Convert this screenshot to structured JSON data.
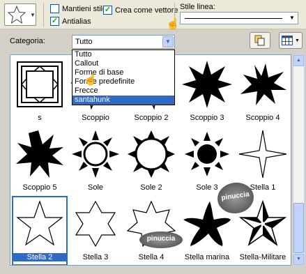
{
  "toolbar": {
    "mantieni_stile": "Mantieni stile",
    "antialias": "Antialias",
    "crea_come_vettore": "Crea come vettore",
    "stile_linea_label": "Stile linea:"
  },
  "categoria": {
    "label": "Categoria:",
    "selected": "Tutto",
    "options": [
      "Tutto",
      "Callout",
      "Forme di base",
      "Forme predefinite",
      "Frecce",
      "santahunk"
    ],
    "highlighted_index": 5
  },
  "shapes": [
    {
      "label": "s"
    },
    {
      "label": "Scoppio"
    },
    {
      "label": "Scoppio 2"
    },
    {
      "label": "Scoppio 3"
    },
    {
      "label": "Scoppio 4"
    },
    {
      "label": "Scoppio 5"
    },
    {
      "label": "Sole"
    },
    {
      "label": "Sole 2"
    },
    {
      "label": "Sole 3"
    },
    {
      "label": "Stella 1"
    },
    {
      "label": "Stella 2"
    },
    {
      "label": "Stella 3"
    },
    {
      "label": "Stella 4"
    },
    {
      "label": "Stella marina"
    },
    {
      "label": "Stella-Militare"
    }
  ],
  "selected_shape": "Stella 2",
  "watermark": "pinuccia",
  "colors": {
    "selection": "#316ac5",
    "checkbox_check": "#21a121"
  }
}
